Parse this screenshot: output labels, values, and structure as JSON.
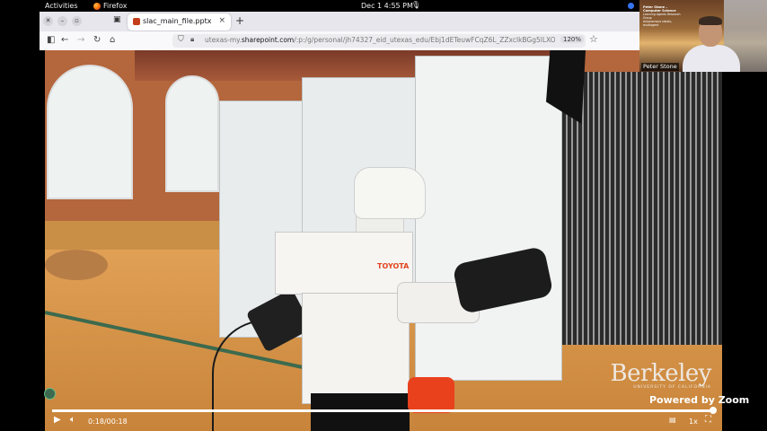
{
  "gnome": {
    "activities": "Activities",
    "app": "Firefox",
    "clock": "Dec 1  4:55 PM",
    "system_glyph": "🎙"
  },
  "browser": {
    "tab_title": "slac_main_file.pptx",
    "tab_close": "×",
    "new_tab": "+",
    "url_prefix": "utexas-my.",
    "url_domain": "sharepoint.com",
    "url_rest": "/:p:/g/personal/jh74327_eid_utexas_edu/Ebj1dETeuwFCqZ6L_ZZxclkBGg5lLXOFnh",
    "zoom": "120%"
  },
  "video": {
    "watermark_title": "Berkeley",
    "watermark_subtitle": "UNIVERSITY OF CALIFORNIA",
    "powered_by": "Powered by Zoom",
    "robot_logo": "TOYOTA",
    "time": "0:18/00:18",
    "progress": 1.0,
    "speed": "1x"
  },
  "speaker": {
    "name": "Peter Stone",
    "slide_title": "Peter Stone – Computer Science",
    "slide_lines": [
      "Learning Agents Research Group",
      "Autonomous robots, multiagent"
    ]
  },
  "colors": {
    "accent": "#3574f0",
    "tab_favicon": "#c43e1c",
    "robot_accent": "#e2451f"
  }
}
